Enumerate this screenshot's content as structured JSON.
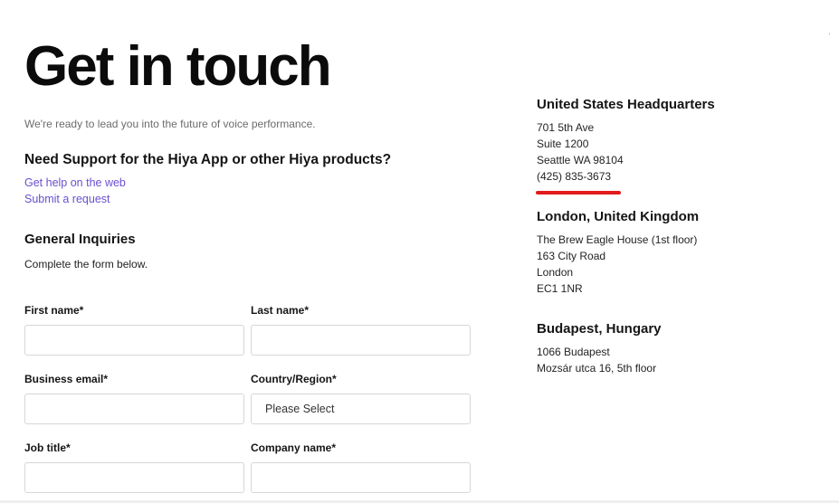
{
  "page_title": "Get in touch",
  "intro": "We're ready to lead you into the future of voice performance.",
  "support": {
    "heading": "Need Support for the Hiya App or other Hiya products?",
    "links": [
      "Get help on the web",
      "Submit a request"
    ]
  },
  "general": {
    "heading": "General Inquiries",
    "subtext": "Complete the form below."
  },
  "form": {
    "first_name_label": "First name*",
    "last_name_label": "Last name*",
    "business_email_label": "Business email*",
    "country_label": "Country/Region*",
    "country_value": "Please Select",
    "job_title_label": "Job title*",
    "company_name_label": "Company name*"
  },
  "offices": [
    {
      "title": "United States Headquarters",
      "lines": [
        "701 5th Ave",
        "Suite 1200",
        "Seattle WA 98104",
        "(425) 835-3673"
      ]
    },
    {
      "title": "London, United Kingdom",
      "lines": [
        "The Brew Eagle House (1st floor)",
        "163 City Road",
        "London",
        "EC1 1NR"
      ]
    },
    {
      "title": "Budapest, Hungary",
      "lines": [
        "1066 Budapest",
        "Mozsár utca 16, 5th floor"
      ]
    }
  ],
  "colors": {
    "link": "#6a4fd1",
    "phone_underline": "#e11b1b",
    "input_border": "#d4d6da"
  }
}
